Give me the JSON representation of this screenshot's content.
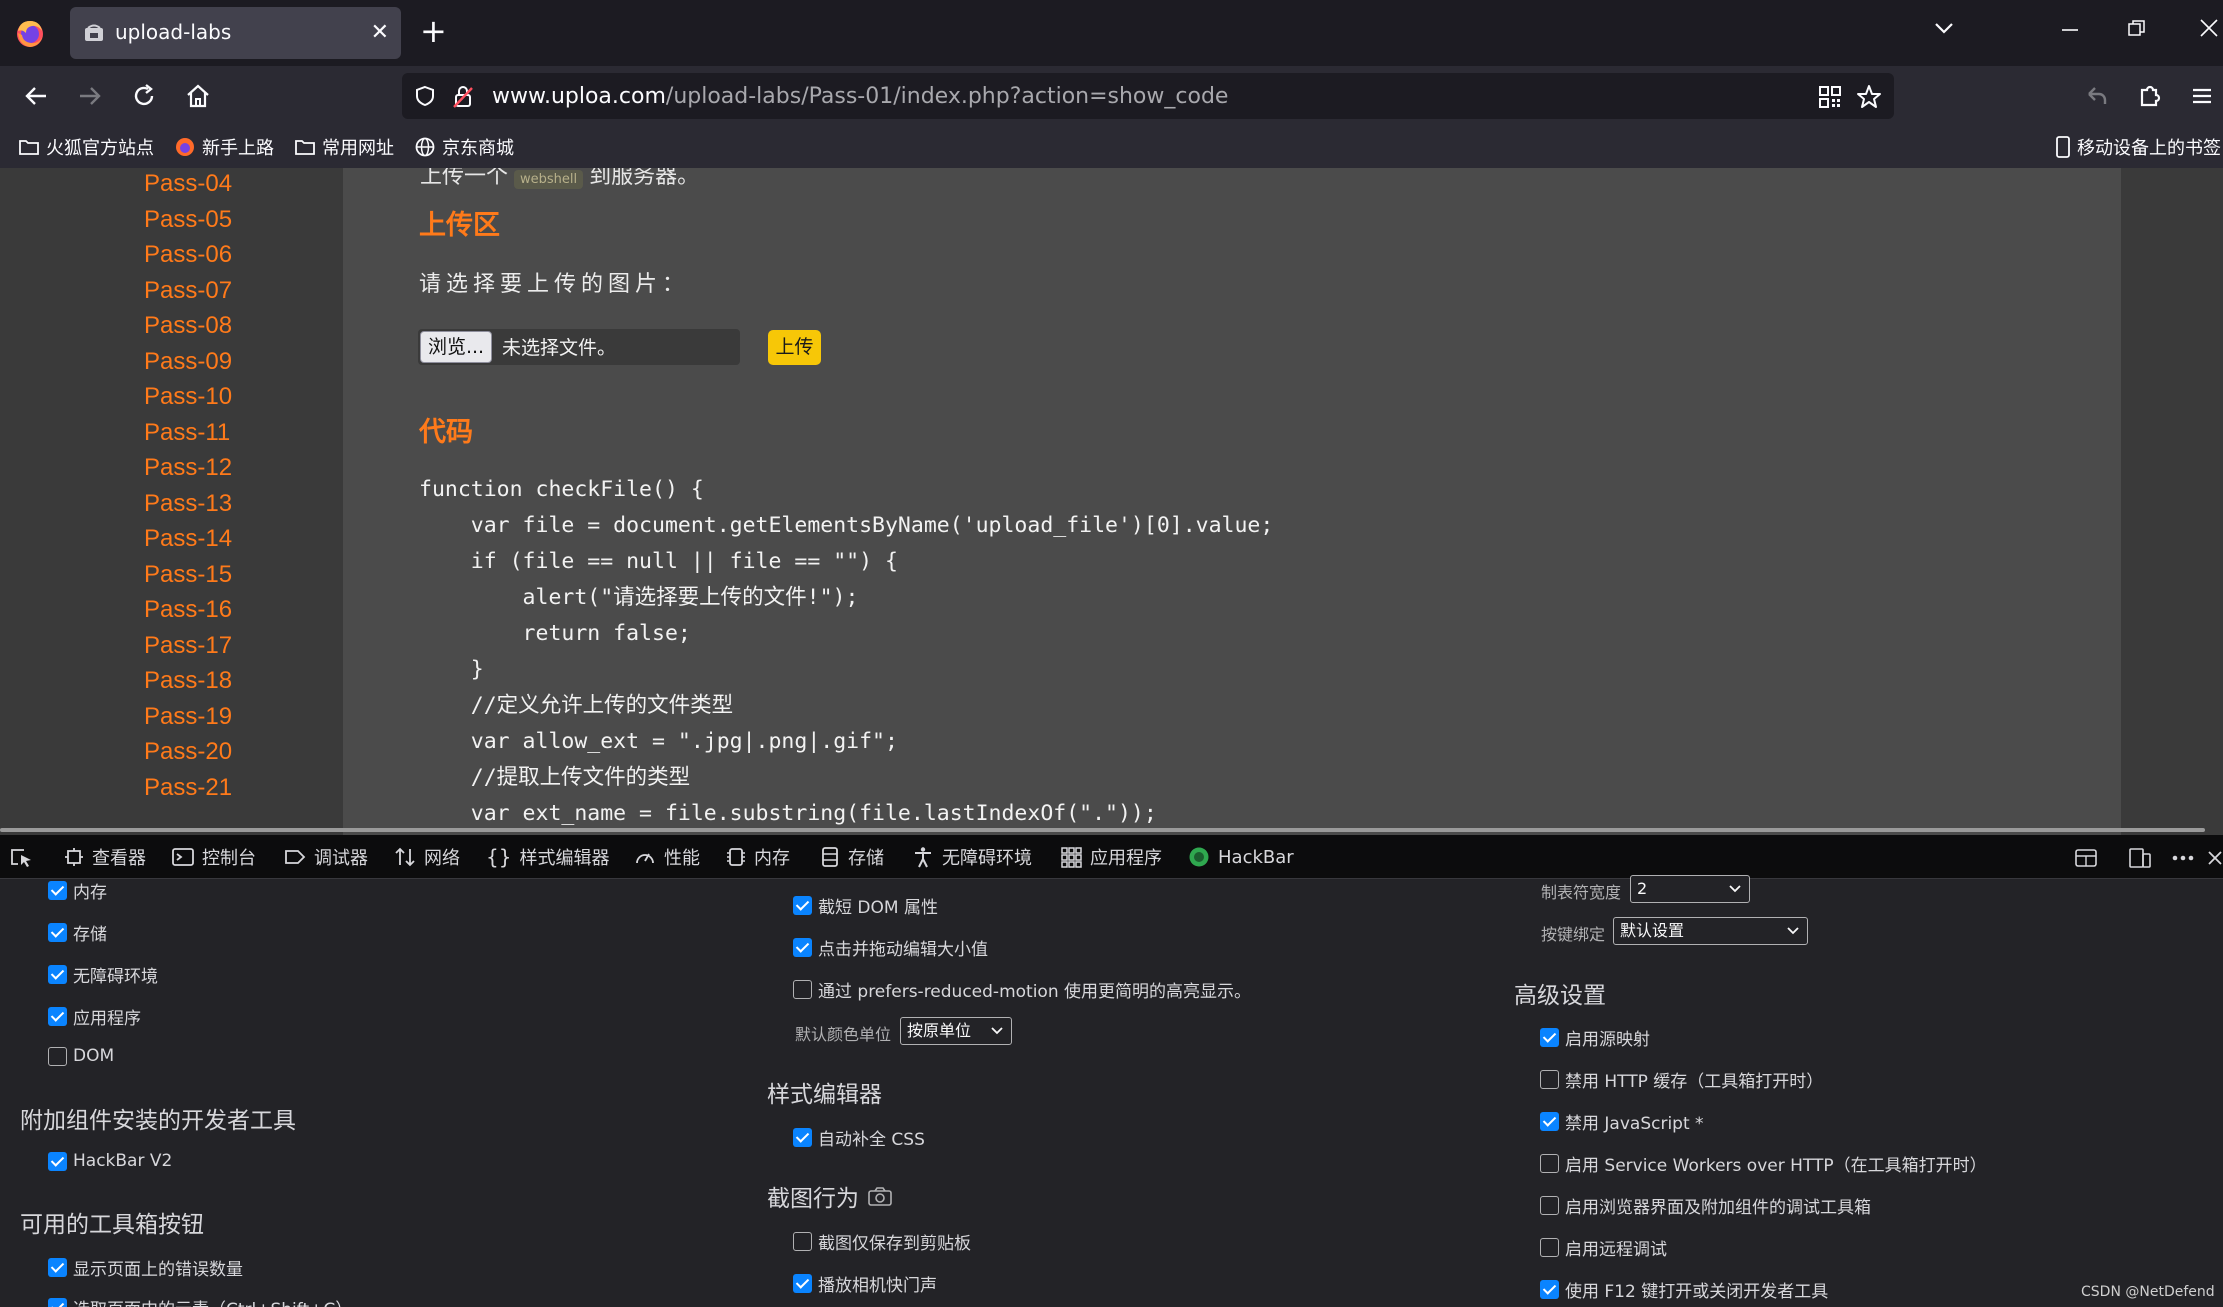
{
  "browser": {
    "tab_title": "upload-labs",
    "url_host": "www.uploa.com",
    "url_path": "/upload-labs/Pass-01/index.php?action=show_code",
    "bookmarks": [
      "火狐官方站点",
      "新手上路",
      "常用网址",
      "京东商城"
    ],
    "mobile_bookmarks": "移动设备上的书签"
  },
  "sidebar": {
    "items": [
      "Pass-04",
      "Pass-05",
      "Pass-06",
      "Pass-07",
      "Pass-08",
      "Pass-09",
      "Pass-10",
      "Pass-11",
      "Pass-12",
      "Pass-13",
      "Pass-14",
      "Pass-15",
      "Pass-16",
      "Pass-17",
      "Pass-18",
      "Pass-19",
      "Pass-20",
      "Pass-21"
    ]
  },
  "content": {
    "intro_start": "上传一个",
    "intro_code": "webshell",
    "intro_end": "到服务器。",
    "upload_heading": "上传区",
    "select_prompt": "请选择要上传的图片：",
    "browse_label": "浏览...",
    "file_status": "未选择文件。",
    "upload_button": "上传",
    "code_heading": "代码",
    "code_lines": [
      "function checkFile() {",
      "    var file = document.getElementsByName('upload_file')[0].value;",
      "    if (file == null || file == \"\") {",
      "        alert(\"请选择要上传的文件!\");",
      "        return false;",
      "    }",
      "    //定义允许上传的文件类型",
      "    var allow_ext = \".jpg|.png|.gif\";",
      "    //提取上传文件的类型",
      "    var ext_name = file.substring(file.lastIndexOf(\".\"));"
    ]
  },
  "devtools": {
    "tabs": [
      "查看器",
      "控制台",
      "调试器",
      "网络",
      "样式编辑器",
      "性能",
      "内存",
      "存储",
      "无障碍环境",
      "应用程序",
      "HackBar"
    ],
    "col1": {
      "options": [
        {
          "label": "内存",
          "checked": true
        },
        {
          "label": "存储",
          "checked": true
        },
        {
          "label": "无障碍环境",
          "checked": true
        },
        {
          "label": "应用程序",
          "checked": true
        },
        {
          "label": "DOM",
          "checked": false
        }
      ],
      "addon_heading": "附加组件安装的开发者工具",
      "addon_options": [
        {
          "label": "HackBar V2",
          "checked": true
        }
      ],
      "toolbox_heading": "可用的工具箱按钮",
      "toolbox_options": [
        {
          "label": "显示页面上的错误数量",
          "checked": true
        },
        {
          "label": "选取页面中的元素（Ctrl+Shift+C）",
          "checked": true
        }
      ]
    },
    "col2": {
      "options": [
        {
          "label": "截短 DOM 属性",
          "checked": true
        },
        {
          "label": "点击并拖动编辑大小值",
          "checked": true
        },
        {
          "label": "通过 prefers-reduced-motion 使用更简明的高亮显示。",
          "checked": false
        }
      ],
      "color_unit_label": "默认颜色单位",
      "color_unit_value": "按原单位",
      "style_heading": "样式编辑器",
      "style_options": [
        {
          "label": "自动补全 CSS",
          "checked": true
        }
      ],
      "screenshot_heading": "截图行为",
      "screenshot_options": [
        {
          "label": "截图仅保存到剪贴板",
          "checked": false
        },
        {
          "label": "播放相机快门声",
          "checked": true
        }
      ]
    },
    "col3": {
      "tab_width_label": "制表符宽度",
      "tab_width_value": "2",
      "keybinding_label": "按键绑定",
      "keybinding_value": "默认设置",
      "advanced_heading": "高级设置",
      "advanced_options": [
        {
          "label": "启用源映射",
          "checked": true
        },
        {
          "label": "禁用 HTTP 缓存（工具箱打开时）",
          "checked": false
        },
        {
          "label": "禁用 JavaScript *",
          "checked": true
        },
        {
          "label": "启用 Service Workers over HTTP（在工具箱打开时）",
          "checked": false
        },
        {
          "label": "启用浏览器界面及附加组件的调试工具箱",
          "checked": false
        },
        {
          "label": "启用远程调试",
          "checked": false
        },
        {
          "label": "使用 F12 键打开或关闭开发者工具",
          "checked": true
        }
      ]
    },
    "watermark": "CSDN @NetDefend"
  },
  "colors": {
    "accent_orange": "#ff7a1a",
    "upload_yellow": "#f7c707",
    "checkbox_blue": "#0a84ff"
  },
  "icons": [
    "firefox-logo-icon",
    "back-icon",
    "forward-icon",
    "reload-icon",
    "home-icon",
    "shield-icon",
    "lock-icon",
    "qr-code-icon",
    "star-icon",
    "undo-icon",
    "extensions-icon",
    "menu-icon",
    "folder-icon",
    "globe-icon",
    "pick-element-icon",
    "camera-icon"
  ]
}
